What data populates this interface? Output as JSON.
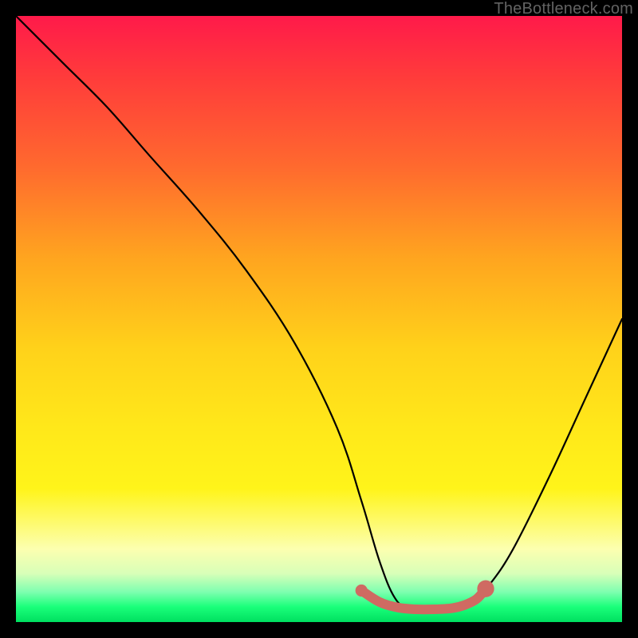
{
  "watermark": "TheBottleneck.com",
  "chart_data": {
    "type": "line",
    "title": "",
    "xlabel": "",
    "ylabel": "",
    "xlim": [
      0,
      100
    ],
    "ylim": [
      0,
      100
    ],
    "series": [
      {
        "name": "bottleneck-curve",
        "color": "#000000",
        "x": [
          0,
          3,
          8,
          15,
          22,
          30,
          38,
          46,
          53,
          57,
          60,
          62.5,
          65,
          68,
          72,
          75,
          78,
          82,
          88,
          94,
          100
        ],
        "y": [
          100,
          97,
          92,
          85,
          77,
          68,
          58,
          46,
          32,
          20,
          10,
          4,
          2,
          2,
          2,
          3,
          6,
          12,
          24,
          37,
          50
        ]
      },
      {
        "name": "optimal-range",
        "color": "#cf6a62",
        "x": [
          57,
          60,
          63,
          66,
          69,
          72,
          74,
          76,
          77.5
        ],
        "y": [
          5.2,
          3.3,
          2.4,
          2.1,
          2.1,
          2.3,
          2.8,
          3.8,
          5.5
        ]
      }
    ],
    "markers": [
      {
        "name": "optimal-start-dot",
        "x": 57,
        "y": 5.2,
        "color": "#cf6a62",
        "r": 1.0
      },
      {
        "name": "optimal-end-dot",
        "x": 77.5,
        "y": 5.5,
        "color": "#cf6a62",
        "r": 1.4
      }
    ],
    "grid": false,
    "legend": false
  }
}
